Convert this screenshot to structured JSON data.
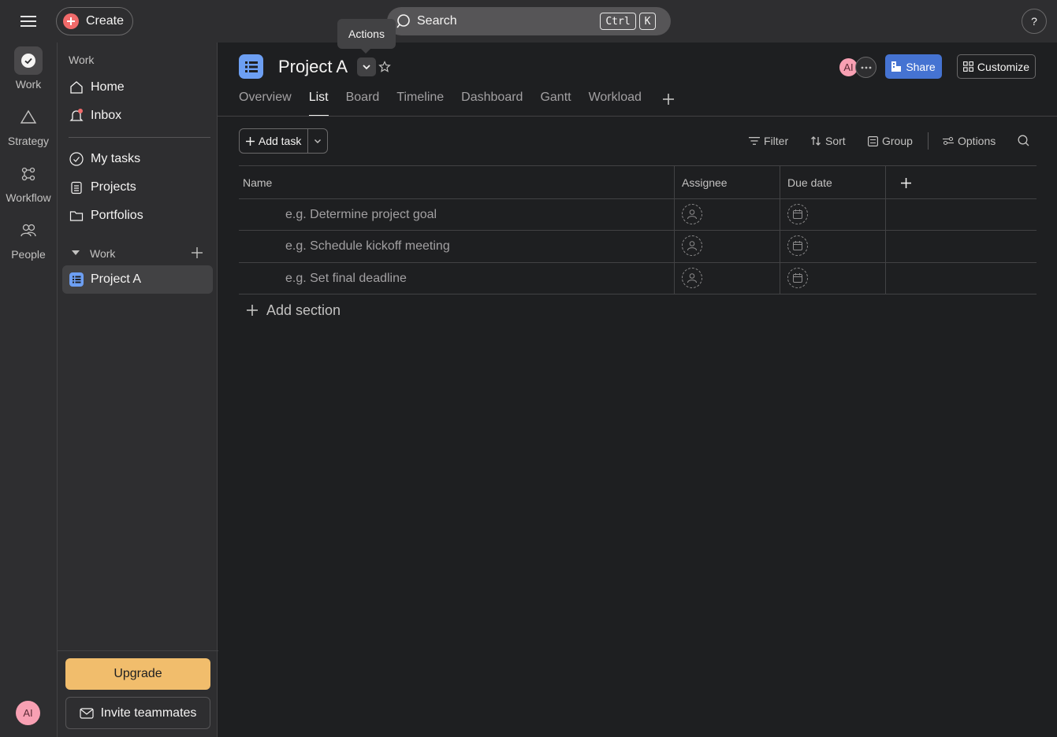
{
  "topbar": {
    "create_label": "Create",
    "search_label": "Search",
    "kbd_ctrl": "Ctrl",
    "kbd_k": "K",
    "help_label": "?"
  },
  "rail": {
    "items": [
      {
        "label": "Work",
        "icon": "check-circle-icon"
      },
      {
        "label": "Strategy",
        "icon": "triangle-icon"
      },
      {
        "label": "Workflow",
        "icon": "workflow-icon"
      },
      {
        "label": "People",
        "icon": "people-icon"
      }
    ],
    "avatar_initials": "AI"
  },
  "sidebar": {
    "heading": "Work",
    "nav": [
      {
        "label": "Home",
        "icon": "home-icon"
      },
      {
        "label": "Inbox",
        "icon": "bell-icon"
      }
    ],
    "nav2": [
      {
        "label": "My tasks",
        "icon": "check-circle-icon"
      },
      {
        "label": "Projects",
        "icon": "clipboard-icon"
      },
      {
        "label": "Portfolios",
        "icon": "folder-icon"
      }
    ],
    "section_title": "Work",
    "project": "Project A",
    "upgrade_label": "Upgrade",
    "invite_label": "Invite teammates"
  },
  "header": {
    "title": "Project A",
    "tooltip": "Actions",
    "avatar_initials": "AI",
    "share_label": "Share",
    "customize_label": "Customize",
    "tabs": [
      "Overview",
      "List",
      "Board",
      "Timeline",
      "Dashboard",
      "Gantt",
      "Workload"
    ],
    "active_tab": "List"
  },
  "toolbar": {
    "add_task_label": "Add task",
    "filter_label": "Filter",
    "sort_label": "Sort",
    "group_label": "Group",
    "options_label": "Options"
  },
  "table": {
    "columns": [
      "Name",
      "Assignee",
      "Due date"
    ],
    "rows": [
      {
        "name": "e.g. Determine project goal"
      },
      {
        "name": "e.g. Schedule kickoff meeting"
      },
      {
        "name": "e.g. Set final deadline"
      }
    ],
    "add_section_label": "Add section"
  },
  "colors": {
    "background": "#1e1f21",
    "panel": "#2e2e30",
    "accent_blue": "#4573d2",
    "upgrade": "#f1bd6c",
    "create_red": "#f06a6a",
    "avatar_pink": "#f8a0b3",
    "project_icon": "#6d9ff3"
  }
}
